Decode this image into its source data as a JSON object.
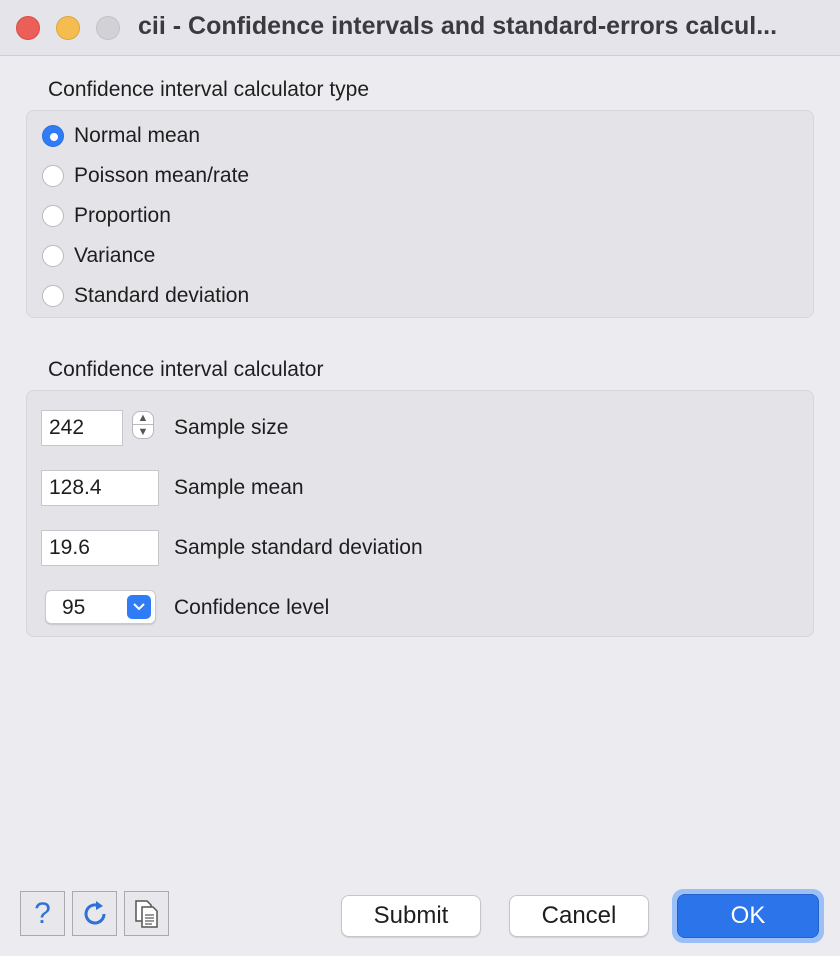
{
  "window": {
    "title": "cii - Confidence intervals and standard-errors calcul..."
  },
  "type_section": {
    "label": "Confidence interval calculator type",
    "options": [
      {
        "label": "Normal mean",
        "checked": true
      },
      {
        "label": "Poisson mean/rate",
        "checked": false
      },
      {
        "label": "Proportion",
        "checked": false
      },
      {
        "label": "Variance",
        "checked": false
      },
      {
        "label": "Standard deviation",
        "checked": false
      }
    ]
  },
  "calc_section": {
    "label": "Confidence interval calculator",
    "sample_size": {
      "value": "242",
      "label": "Sample size"
    },
    "sample_mean": {
      "value": "128.4",
      "label": "Sample mean"
    },
    "sample_sd": {
      "value": "19.6",
      "label": "Sample standard deviation"
    },
    "confidence": {
      "value": "95",
      "label": "Confidence level"
    }
  },
  "footer": {
    "icons": [
      "help-icon",
      "reset-icon",
      "copy-icon"
    ],
    "help_glyph": "?",
    "submit_label": "Submit",
    "cancel_label": "Cancel",
    "ok_label": "OK"
  },
  "colors": {
    "accent": "#2f7cf6",
    "close": "#ec5f59",
    "minimize": "#f5bd4f"
  }
}
